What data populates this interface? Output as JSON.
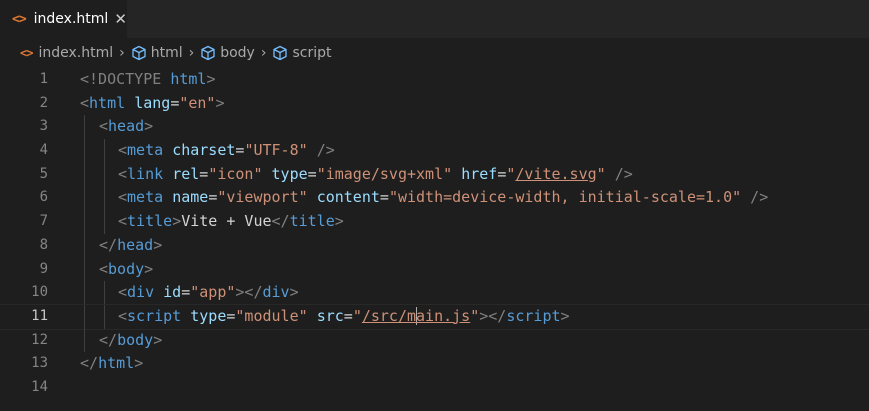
{
  "tab": {
    "icon": "<>",
    "label": "index.html",
    "close": "✕"
  },
  "breadcrumb": [
    {
      "label": "index.html",
      "icon": "html-icon"
    },
    {
      "label": "html",
      "icon": "cube-icon"
    },
    {
      "label": "body",
      "icon": "cube-icon"
    },
    {
      "label": "script",
      "icon": "cube-icon"
    }
  ],
  "breadcrumb_separator": "›",
  "current_line": 11,
  "lines": [
    {
      "n": "1",
      "indent": 0,
      "tokens": [
        [
          "b",
          "<"
        ],
        [
          "b",
          "!DOCTYPE"
        ],
        [
          "x",
          " "
        ],
        [
          "t",
          "html"
        ],
        [
          "b",
          ">"
        ]
      ]
    },
    {
      "n": "2",
      "indent": 0,
      "tokens": [
        [
          "b",
          "<"
        ],
        [
          "t",
          "html"
        ],
        [
          "x",
          " "
        ],
        [
          "a",
          "lang"
        ],
        [
          "e",
          "="
        ],
        [
          "s",
          "\"en\""
        ],
        [
          "b",
          ">"
        ]
      ]
    },
    {
      "n": "3",
      "indent": 1,
      "tokens": [
        [
          "b",
          "<"
        ],
        [
          "t",
          "head"
        ],
        [
          "b",
          ">"
        ]
      ]
    },
    {
      "n": "4",
      "indent": 2,
      "tokens": [
        [
          "b",
          "<"
        ],
        [
          "t",
          "meta"
        ],
        [
          "x",
          " "
        ],
        [
          "a",
          "charset"
        ],
        [
          "e",
          "="
        ],
        [
          "s",
          "\"UTF-8\""
        ],
        [
          "x",
          " "
        ],
        [
          "b",
          "/>"
        ]
      ]
    },
    {
      "n": "5",
      "indent": 2,
      "tokens": [
        [
          "b",
          "<"
        ],
        [
          "t",
          "link"
        ],
        [
          "x",
          " "
        ],
        [
          "a",
          "rel"
        ],
        [
          "e",
          "="
        ],
        [
          "s",
          "\"icon\""
        ],
        [
          "x",
          " "
        ],
        [
          "a",
          "type"
        ],
        [
          "e",
          "="
        ],
        [
          "s",
          "\"image/svg+xml\""
        ],
        [
          "x",
          " "
        ],
        [
          "a",
          "href"
        ],
        [
          "e",
          "="
        ],
        [
          "s",
          "\""
        ],
        [
          "sl",
          "/vite.svg"
        ],
        [
          "s",
          "\""
        ],
        [
          "x",
          " "
        ],
        [
          "b",
          "/>"
        ]
      ]
    },
    {
      "n": "6",
      "indent": 2,
      "tokens": [
        [
          "b",
          "<"
        ],
        [
          "t",
          "meta"
        ],
        [
          "x",
          " "
        ],
        [
          "a",
          "name"
        ],
        [
          "e",
          "="
        ],
        [
          "s",
          "\"viewport\""
        ],
        [
          "x",
          " "
        ],
        [
          "a",
          "content"
        ],
        [
          "e",
          "="
        ],
        [
          "s",
          "\"width=device-width, initial-scale=1.0\""
        ],
        [
          "x",
          " "
        ],
        [
          "b",
          "/>"
        ]
      ]
    },
    {
      "n": "7",
      "indent": 2,
      "tokens": [
        [
          "b",
          "<"
        ],
        [
          "t",
          "title"
        ],
        [
          "b",
          ">"
        ],
        [
          "x",
          "Vite + Vue"
        ],
        [
          "b",
          "</"
        ],
        [
          "t",
          "title"
        ],
        [
          "b",
          ">"
        ]
      ]
    },
    {
      "n": "8",
      "indent": 1,
      "tokens": [
        [
          "b",
          "</"
        ],
        [
          "t",
          "head"
        ],
        [
          "b",
          ">"
        ]
      ]
    },
    {
      "n": "9",
      "indent": 1,
      "tokens": [
        [
          "b",
          "<"
        ],
        [
          "t",
          "body"
        ],
        [
          "b",
          ">"
        ]
      ]
    },
    {
      "n": "10",
      "indent": 2,
      "tokens": [
        [
          "b",
          "<"
        ],
        [
          "t",
          "div"
        ],
        [
          "x",
          " "
        ],
        [
          "a",
          "id"
        ],
        [
          "e",
          "="
        ],
        [
          "s",
          "\"app\""
        ],
        [
          "b",
          "></"
        ],
        [
          "t",
          "div"
        ],
        [
          "b",
          ">"
        ]
      ]
    },
    {
      "n": "11",
      "indent": 2,
      "tokens": [
        [
          "b",
          "<"
        ],
        [
          "t",
          "script"
        ],
        [
          "x",
          " "
        ],
        [
          "a",
          "type"
        ],
        [
          "e",
          "="
        ],
        [
          "s",
          "\"module\""
        ],
        [
          "x",
          " "
        ],
        [
          "a",
          "src"
        ],
        [
          "e",
          "="
        ],
        [
          "s",
          "\""
        ],
        [
          "sl",
          "/src/m"
        ],
        [
          "caret",
          ""
        ],
        [
          "sl",
          "ain.js"
        ],
        [
          "s",
          "\""
        ],
        [
          "b",
          "></"
        ],
        [
          "t",
          "script"
        ],
        [
          "b",
          ">"
        ]
      ]
    },
    {
      "n": "12",
      "indent": 1,
      "tokens": [
        [
          "b",
          "</"
        ],
        [
          "t",
          "body"
        ],
        [
          "b",
          ">"
        ]
      ]
    },
    {
      "n": "13",
      "indent": 0,
      "tokens": [
        [
          "b",
          "</"
        ],
        [
          "t",
          "html"
        ],
        [
          "b",
          ">"
        ]
      ]
    },
    {
      "n": "14",
      "indent": 0,
      "tokens": []
    }
  ],
  "colors": {
    "tag": "#569cd6",
    "attribute": "#9cdcfe",
    "string": "#ce9178",
    "bracket": "#808080",
    "html_icon": "#e37933"
  }
}
